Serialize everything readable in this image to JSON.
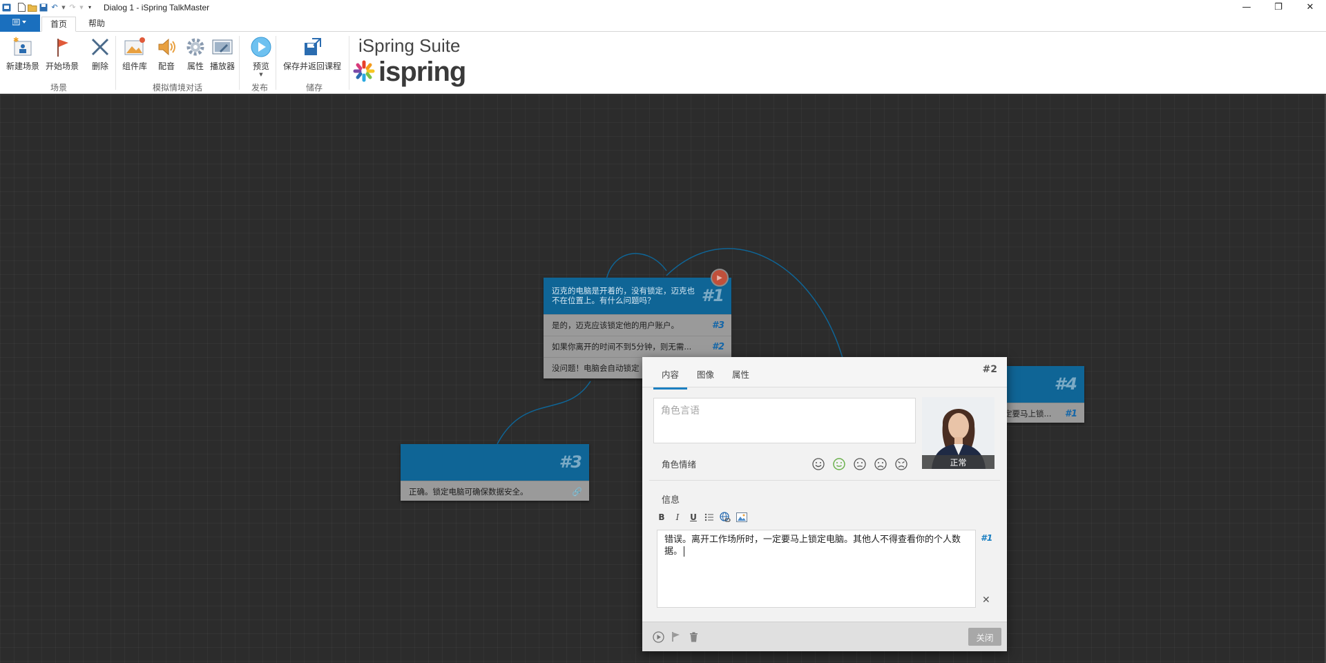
{
  "window": {
    "title": "Dialog 1 - iSpring TalkMaster",
    "controls": {
      "minimize": "—",
      "restore": "❐",
      "close": "✕"
    }
  },
  "ribbon_tabs": {
    "file_icon": "menu-icon",
    "home": "首页",
    "help": "帮助"
  },
  "ribbon": {
    "buttons": {
      "new_scene": "新建场景",
      "start_scene": "开始场景",
      "delete": "删除",
      "library": "组件库",
      "audio": "配音",
      "properties": "属性",
      "player": "播放器",
      "preview": "预览",
      "save_return": "保存并返回课程"
    },
    "groups": {
      "scene": "场景",
      "simulation": "模拟情境对话",
      "publish": "发布",
      "save": "储存"
    },
    "suite_title": "iSpring Suite",
    "logo_text": "ispring"
  },
  "nodes": {
    "n1": {
      "num": "#1",
      "text": "迈克的电脑是开着的，没有锁定，迈克也不在位置上。有什么问题吗？",
      "rows": [
        {
          "text": "是的，迈克应该锁定他的用户账户。",
          "link": "#3"
        },
        {
          "text": "如果你离开的时间不到5分钟，则无需...",
          "link": "#2"
        },
        {
          "text": "没问题！电脑会自动锁定",
          "link": ""
        }
      ]
    },
    "n3": {
      "num": "#3",
      "row": "正确。锁定电脑可确保数据安全。"
    },
    "n4": {
      "num": "#4",
      "row": "定要马上锁...",
      "link": "#1"
    }
  },
  "panel": {
    "tabs": {
      "content": "内容",
      "image": "图像",
      "properties": "属性"
    },
    "num": "#2",
    "speech_placeholder": "角色言语",
    "emotion_label": "角色情绪",
    "avatar_caption": "正常",
    "info_label": "信息",
    "message": "错误。离开工作场所时，一定要马上锁定电脑。其他人不得查看你的个人数据。",
    "message_link": "#1",
    "close_label": "关闭"
  },
  "colors": {
    "accent": "#1b7fc1",
    "node_head": "#0f6596",
    "file_tab": "#1a6fbe"
  }
}
